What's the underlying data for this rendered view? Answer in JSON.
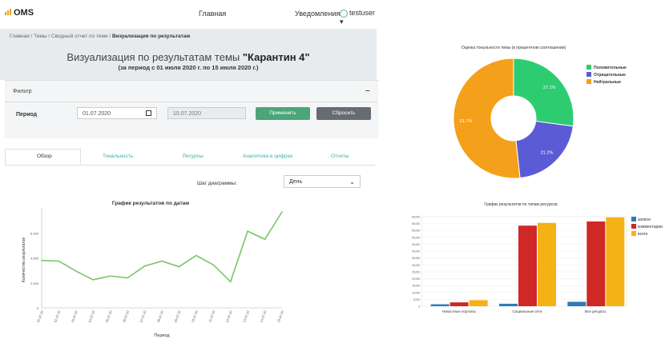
{
  "navbar": {
    "logo": "OMS",
    "main_link": "Главная",
    "notifications": "Уведомления",
    "user": "testuser"
  },
  "breadcrumb": {
    "items": [
      "Главная",
      "Темы",
      "Сводный отчет по теме"
    ],
    "current": "Визуализация по результатам",
    "sep": " / "
  },
  "page": {
    "title_prefix": "Визуализация по результатам темы ",
    "title_topic": "\"Карантин 4\"",
    "subtitle": "(за период с 01 июля 2020 г. по 15 июля 2020 г.)"
  },
  "filter": {
    "title": "Фильтр",
    "collapse": "–",
    "period_label": "Период",
    "date_from": "01.07.2020",
    "date_to": "15.07.2020",
    "apply": "Применить",
    "reset": "Сбросить"
  },
  "tabs": [
    "Обзор",
    "Тональность",
    "Ресурсы",
    "Аналитика в цифрах",
    "Отчеты"
  ],
  "step": {
    "label": "Шаг диаграммы:",
    "value": "День"
  },
  "chart_data": [
    {
      "type": "line",
      "title": "График результатов по датам",
      "xlabel": "Период",
      "ylabel": "Количество результатов",
      "x": [
        "01.07.20",
        "02.07.20",
        "03.07.20",
        "04.07.20",
        "05.07.20",
        "06.07.20",
        "07.07.20",
        "08.07.20",
        "09.07.20",
        "10.07.20",
        "11.07.20",
        "12.07.20",
        "13.07.20",
        "14.07.20",
        "15.07.20"
      ],
      "values": [
        3800,
        3750,
        2950,
        2250,
        2550,
        2400,
        3350,
        3750,
        3300,
        4200,
        3450,
        2100,
        6150,
        5500,
        7700
      ],
      "yticks": [
        0,
        2000,
        4000,
        6000
      ],
      "ytick_labels": [
        "0",
        "2,000",
        "4,000",
        "6,000"
      ],
      "ylim": [
        0,
        7700
      ],
      "color": "#7cc46a",
      "grid": false
    },
    {
      "type": "pie",
      "title": "Оценка тональности темы (в процентном соотношении)",
      "categories": [
        "Положительные",
        "Отрицательные",
        "Нейтральные"
      ],
      "values": [
        27.1,
        21.2,
        51.7
      ],
      "labels": [
        "27.1%",
        "21.2%",
        "51.7%"
      ],
      "colors": [
        "#2ecc71",
        "#5b5bd6",
        "#f5a01a"
      ],
      "legend": "right"
    },
    {
      "type": "bar",
      "title": "График результатов по типам ресурсов",
      "categories": [
        "Новостные порталы",
        "Социальные сети",
        "Все ресурсы"
      ],
      "series": [
        {
          "name": "записи",
          "values": [
            1400,
            1800,
            3200
          ],
          "color": "#2e7bb8"
        },
        {
          "name": "комментарии",
          "values": [
            2800,
            58500,
            61500
          ],
          "color": "#d02727"
        },
        {
          "name": "всего",
          "values": [
            4400,
            60500,
            64500
          ],
          "color": "#f5b216"
        }
      ],
      "yticks": [
        0,
        5000,
        10000,
        15000,
        20000,
        25000,
        30000,
        35000,
        40000,
        45000,
        50000,
        55000,
        60000,
        65000
      ],
      "ytick_labels": [
        "0",
        "5,000",
        "10,000",
        "15,000",
        "20,000",
        "25,000",
        "30,000",
        "35,000",
        "40,000",
        "45,000",
        "50,000",
        "55,000",
        "60,000",
        "65,000"
      ],
      "ylim": [
        0,
        65000
      ],
      "legend": "right"
    }
  ]
}
